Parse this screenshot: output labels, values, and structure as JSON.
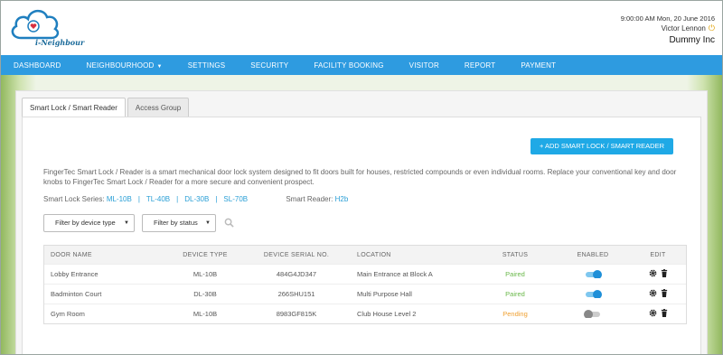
{
  "brand": {
    "logo_text": "i-Neighbour"
  },
  "header": {
    "datetime": "9:00:00 AM Mon, 20 June 2016",
    "user": "Victor Lennon",
    "company": "Dummy Inc"
  },
  "nav": {
    "items": [
      "DASHBOARD",
      "NEIGHBOURHOOD",
      "SETTINGS",
      "SECURITY",
      "FACILITY BOOKING",
      "VISITOR",
      "REPORT",
      "PAYMENT"
    ]
  },
  "tabs": [
    "Smart Lock / Smart Reader",
    "Access Group"
  ],
  "add_button": "+ ADD SMART LOCK / SMART READER",
  "description": "FingerTec Smart Lock / Reader is a smart mechanical door lock system designed to fit doors built for houses, restricted compounds or even individual rooms. Replace your conventional key and door knobs to FingerTec Smart Lock / Reader for a more secure and convenient prospect.",
  "series": {
    "lock_label": "Smart Lock Series:",
    "lock_models": [
      "ML-10B",
      "TL-40B",
      "DL-30B",
      "SL-70B"
    ],
    "reader_label": "Smart Reader:",
    "reader_model": "H2b"
  },
  "filters": {
    "device_type": "Filter by device type",
    "status": "Filter by status"
  },
  "table": {
    "headers": [
      "DOOR NAME",
      "DEVICE TYPE",
      "DEVICE SERIAL NO.",
      "LOCATION",
      "STATUS",
      "ENABLED",
      "EDIT"
    ],
    "rows": [
      {
        "door": "Lobby Entrance",
        "type": "ML-10B",
        "serial": "484G4JD347",
        "location": "Main Entrance at Block A",
        "status": "Paired",
        "enabled": true
      },
      {
        "door": "Badminton Court",
        "type": "DL-30B",
        "serial": "266SHU151",
        "location": "Multi Purpose Hall",
        "status": "Paired",
        "enabled": true
      },
      {
        "door": "Gym Room",
        "type": "ML-10B",
        "serial": "8983GF815K",
        "location": "Club House Level 2",
        "status": "Pending",
        "enabled": false
      }
    ]
  },
  "colors": {
    "nav": "#2e9be0",
    "accent": "#1fa9e6",
    "paired": "#6ab84a",
    "pending": "#f0a030"
  }
}
